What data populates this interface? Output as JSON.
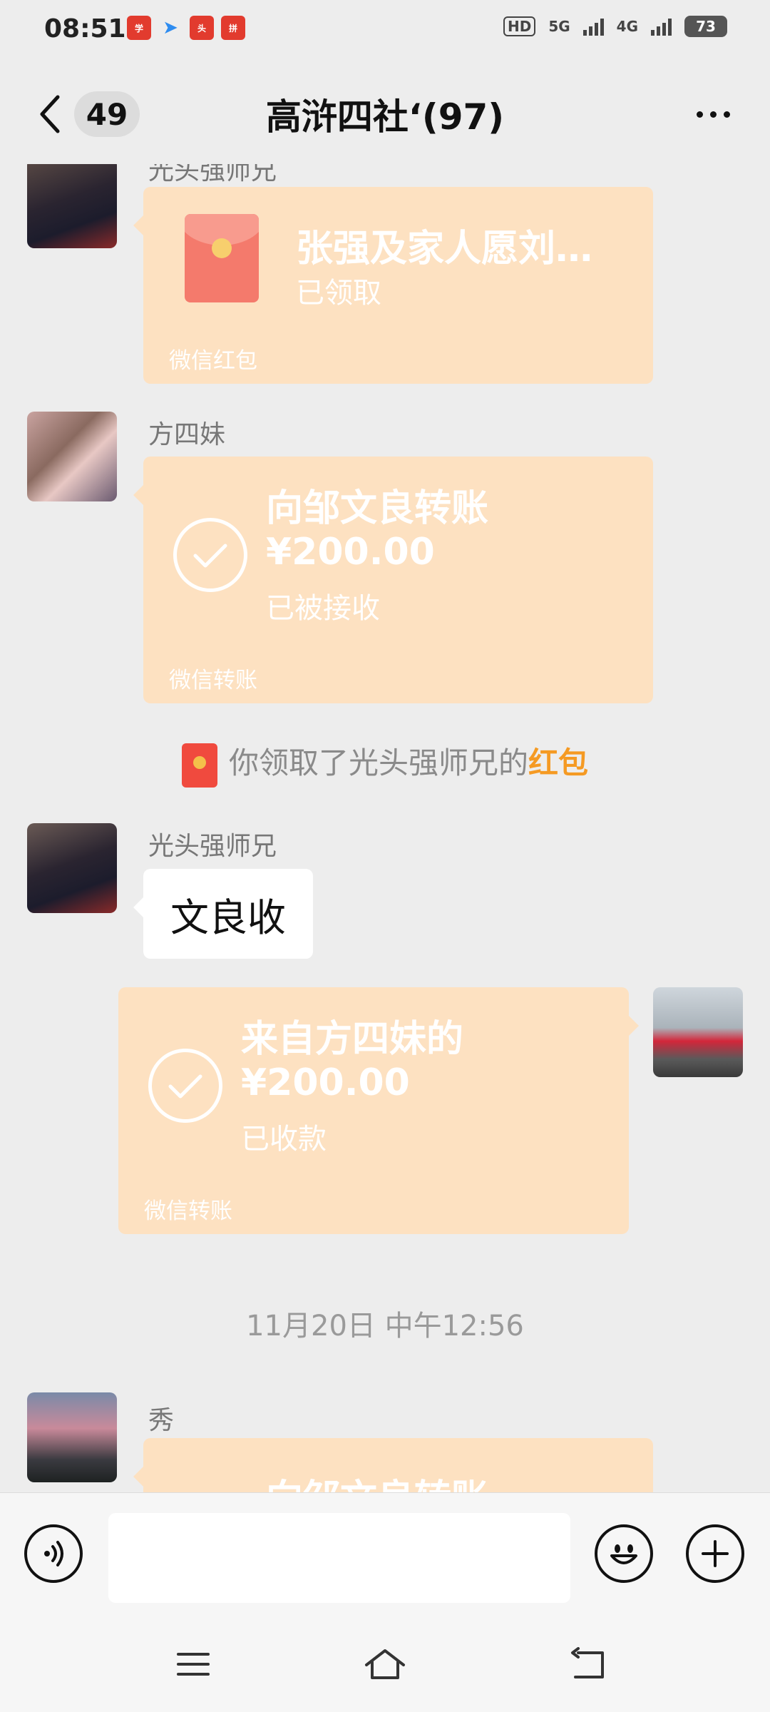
{
  "status_bar": {
    "time": "08:51",
    "notifications": [
      "学习强国",
      "telegram",
      "头条",
      "拼多多"
    ],
    "hd": "HD",
    "net_5g": "5G",
    "net_4g": "4G",
    "battery": "73"
  },
  "header": {
    "unread_count": "49",
    "title": "高浒四社‘(97)"
  },
  "messages": {
    "m1": {
      "sender": "光头强师兄",
      "title": "张强及家人愿刘…",
      "status": "已领取",
      "footer": "微信红包"
    },
    "m2": {
      "sender": "方四妹",
      "title": "向邹文良转账",
      "amount": "¥200.00",
      "status": "已被接收",
      "footer": "微信转账"
    },
    "sys1": {
      "prefix": "你领取了光头强师兄的",
      "highlight": "红包"
    },
    "m3": {
      "sender": "光头强师兄",
      "text": "文良收"
    },
    "m4": {
      "title": "来自方四妹的",
      "amount": "¥200.00",
      "status": "已收款",
      "footer": "微信转账"
    },
    "timestamp": "11月20日 中午12:56",
    "m5": {
      "sender": "秀",
      "title": "向邹文良转账"
    }
  },
  "input": {
    "value": "",
    "placeholder": ""
  },
  "colors": {
    "card": "#fde1c1",
    "highlight": "#f59a23",
    "background": "#ededed"
  }
}
